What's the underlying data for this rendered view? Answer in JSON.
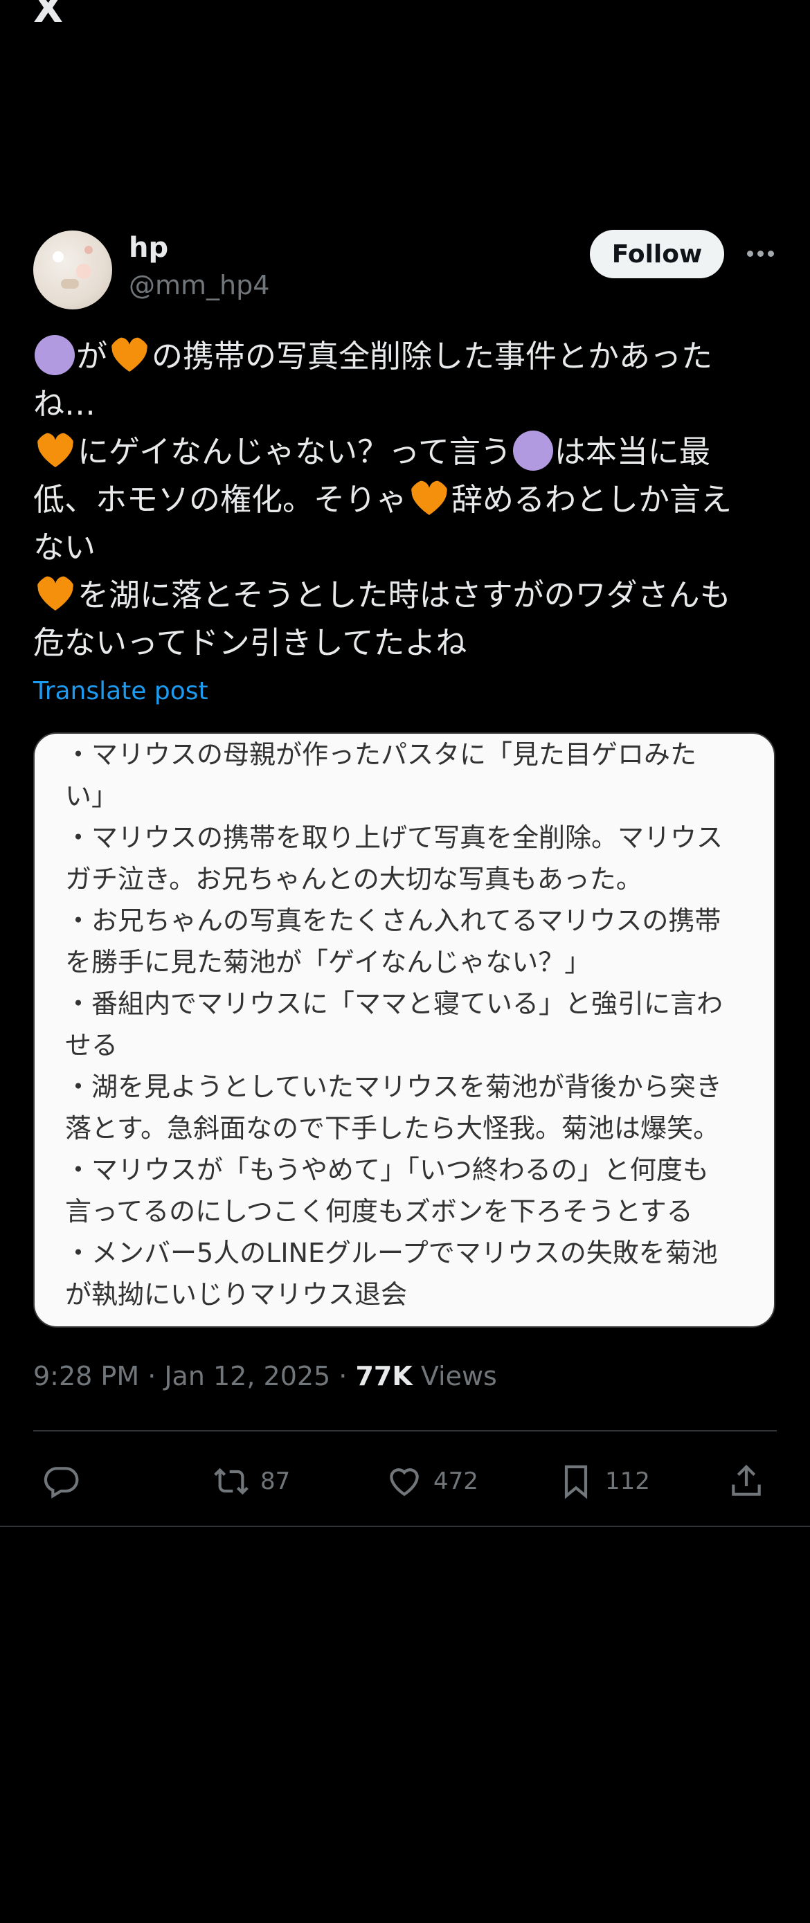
{
  "app": {
    "logo": "X"
  },
  "post": {
    "author_name": "hp",
    "author_handle": "@mm_hp4",
    "follow_label": "Follow",
    "lines": [
      [
        "purple",
        "が",
        "heart",
        "の携帯の写真全削除した事件とかあった"
      ],
      [
        "ね…"
      ],
      [
        "heart",
        "にゲイなんじゃない？って言う",
        "purple",
        "は本当に最"
      ],
      [
        "低、ホモソの権化。そりゃ",
        "heart",
        "辞めるわとしか言え"
      ],
      [
        "ない"
      ],
      [
        "heart",
        "を湖に落とそうとした時はさすがのワダさんも"
      ],
      [
        "危ないってドン引きしてたよね"
      ]
    ],
    "translate_label": "Translate post",
    "image_text_lines": [
      "・マリウスの母親が作ったパスタに「見た目ゲロみた",
      "い」",
      "・マリウスの携帯を取り上げて写真を全削除。マリウス",
      "ガチ泣き。お兄ちゃんとの大切な写真もあった。",
      "・お兄ちゃんの写真をたくさん入れてるマリウスの携帯",
      "を勝手に見た菊池が「ゲイなんじゃない？」",
      "・番組内でマリウスに「ママと寝ている」と強引に言わ",
      "せる",
      "・湖を見ようとしていたマリウスを菊池が背後から突き",
      "落とす。急斜面なので下手したら大怪我。菊池は爆笑。",
      "・マリウスが「もうやめて」「いつ終わるの」と何度も",
      "言ってるのにしつこく何度もズボンを下ろそうとする",
      "・メンバー5人のLINEグループでマリウスの失敗を菊池",
      "が執拗にいじりマリウス退会"
    ],
    "time": "9:28 PM · Jan 12, 2025 · ",
    "views_count": "77K",
    "views_label": " Views"
  },
  "actions": {
    "reply_count": "",
    "repost_count": "87",
    "like_count": "472",
    "bookmark_count": "112"
  },
  "colors": {
    "purple_emoji": "#b29ae0",
    "orange_heart": "#f4900c",
    "link": "#1d9bf0"
  }
}
